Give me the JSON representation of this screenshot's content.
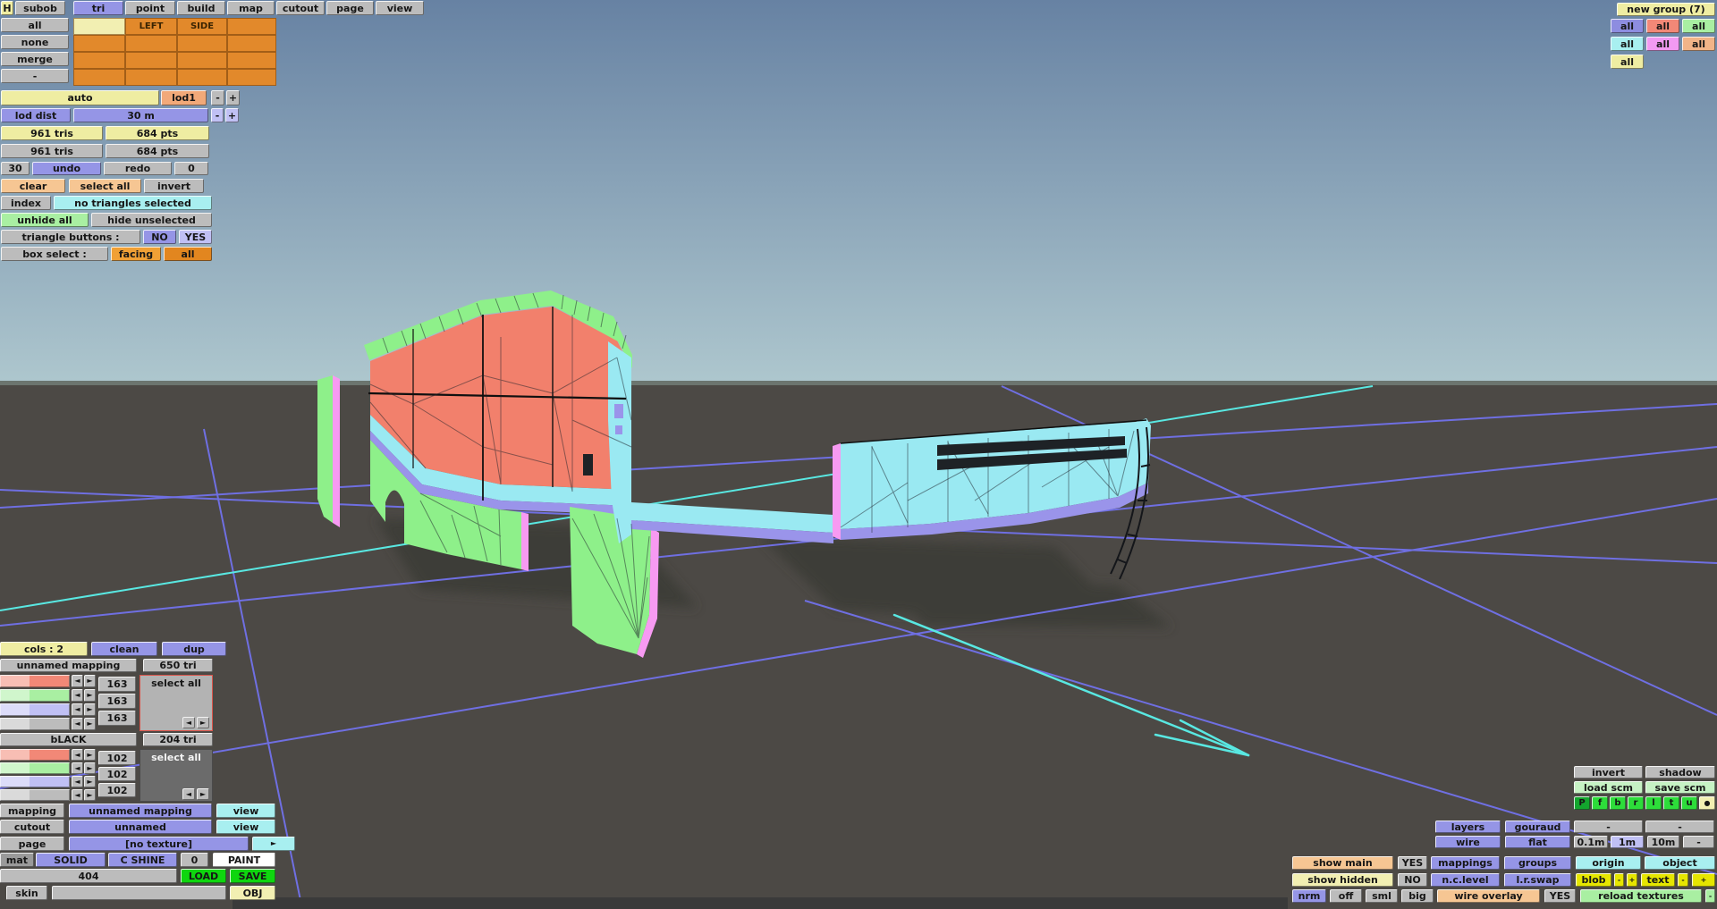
{
  "palette": {
    "gray": "#bcbcbc",
    "grayMid": "#9a9a9a",
    "grayDark": "#6b6b6b",
    "white": "#ffffff",
    "yellow": "#efeda2",
    "paleYellow": "#f2efb2",
    "yellowBright": "#e6e600",
    "orange": "#f0a035",
    "orangeDark": "#e2861f",
    "orangeCell": "#e2892b",
    "peach": "#f6c693",
    "peachLod": "#f2a979",
    "peachAll": "#f2b488",
    "purple": "#9595e6",
    "purpleLight": "#c0c0f4",
    "purpleAll": "#8d8de0",
    "cyan": "#a8eff0",
    "green": "#a9efa2",
    "greenPale": "#c6f2c4",
    "greenBright": "#0fd60f",
    "greenKey": "#2ddd3a",
    "greenKeyDark": "#13a62e",
    "pink": "#f29af2",
    "salmon": "#f28877",
    "skyTop": "#6782a3",
    "skyHorizon": "#aec7ce",
    "ground": "#4c4945",
    "gridPurple": "#6f6fe2",
    "gridCyan": "#59e8e2",
    "treeline": "#555a4f",
    "shadow": "#3e3c39",
    "bottomStrip": "#3a3a3a",
    "modelGreen": "#8ef08a",
    "modelSalmon": "#f2806c",
    "modelCyan": "#9ae9f2",
    "modelPurple": "#9a94ea",
    "modelPink": "#f79af2",
    "wire": "#1d212a",
    "seam": "#101010",
    "slot": "#1e2226"
  },
  "menu": {
    "h": "H",
    "items": [
      "subob",
      "tri",
      "point",
      "build",
      "map",
      "cutout",
      "page",
      "view"
    ]
  },
  "subob": {
    "all": "all",
    "none": "none",
    "merge": "merge",
    "left": "LEFT",
    "side": "SIDE"
  },
  "lod": {
    "auto": "auto",
    "lod1": "lod1",
    "dist_label": "lod dist",
    "dist_value": "30 m"
  },
  "stats": {
    "tris1": "961 tris",
    "pts1": "684 pts",
    "tris2": "961 tris",
    "pts2": "684 pts"
  },
  "history": {
    "undo_count": "30",
    "undo": "undo",
    "redo": "redo",
    "redo_count": "0"
  },
  "selection": {
    "clear": "clear",
    "select_all": "select all",
    "invert": "invert",
    "index": "index",
    "status": "no triangles selected",
    "unhide": "unhide all",
    "hide": "hide unselected",
    "tri_btns": "triangle buttons :",
    "no": "NO",
    "yes": "YES",
    "box_select": "box select :",
    "facing": "facing",
    "all": "all"
  },
  "groups": {
    "title": "new group (7)",
    "all": "all"
  },
  "mapping": {
    "cols": "cols : 2",
    "clean": "clean",
    "dup": "dup",
    "m1": {
      "name": "unnamed mapping",
      "tri": "650 tri",
      "select_all": "select all",
      "values": [
        "163",
        "163",
        "163"
      ]
    },
    "m2": {
      "name": "bLACK",
      "tri": "204 tri",
      "select_all": "select all",
      "values": [
        "102",
        "102",
        "102"
      ]
    }
  },
  "bottom": {
    "mapping": "mapping",
    "mapping_value": "unnamed mapping",
    "view": "view",
    "cutout": "cutout",
    "cutout_value": "unnamed",
    "page": "page",
    "page_value": "[no texture]",
    "mat": "mat",
    "solid": "SOLID",
    "cshine": "C SHINE",
    "zero": "0",
    "paint": "PAINT",
    "num": "404",
    "load": "LOAD",
    "save": "SAVE",
    "skin": "skin",
    "skin_value": "",
    "obj": "OBJ"
  },
  "right": {
    "invert": "invert",
    "shadow": "shadow",
    "load_scm": "load scm",
    "save_scm": "save scm",
    "keys": [
      "P",
      "f",
      "b",
      "r",
      "l",
      "t",
      "u"
    ],
    "layers": "layers",
    "gouraud": "gouraud",
    "wire": "wire",
    "flat": "flat",
    "d01": "0.1m",
    "d1": "1m",
    "d10": "10m",
    "show_main": "show main",
    "yes": "YES",
    "mappings": "mappings",
    "groups": "groups",
    "origin": "origin",
    "object": "object",
    "show_hidden": "show hidden",
    "no": "NO",
    "nclevel": "n.c.level",
    "lrswap": "l.r.swap",
    "blob": "blob",
    "text": "text",
    "nrm": "nrm",
    "off": "off",
    "sml": "sml",
    "big": "big",
    "wire_overlay": "wire overlay",
    "reload": "reload textures"
  },
  "ui": {
    "minus": "-",
    "plus": "+",
    "dash": "-",
    "left_arrow": "◄",
    "right_arrow": "►",
    "play": "►",
    "dot": "●"
  }
}
